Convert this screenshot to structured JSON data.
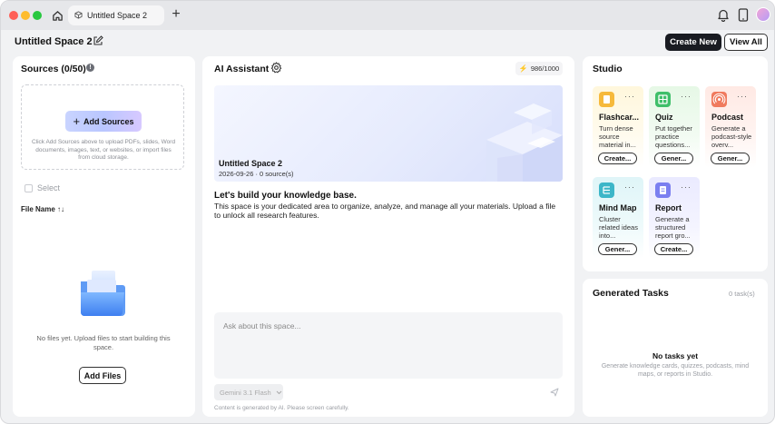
{
  "titlebar": {
    "tab_label": "Untitled Space 2",
    "new_tab_symbol": "+"
  },
  "header": {
    "space_title": "Untitled Space 2",
    "create_new_label": "Create New",
    "view_all_label": "View All"
  },
  "sources": {
    "title": "Sources (0/50)",
    "info_symbol": "!",
    "add_sources_label": "Add Sources",
    "dropzone_hint": "Click Add Sources above to upload PDFs, slides, Word documents, images, text, or websites, or import files from cloud storage.",
    "select_label": "Select",
    "file_name_header": "File Name ↑↓",
    "empty_message": "No files yet. Upload files to start building this space.",
    "add_files_label": "Add Files"
  },
  "assistant": {
    "title": "AI Assistant",
    "credits": "986/1000",
    "hero_title": "Untitled Space 2",
    "hero_subtitle": "2026-09-26 · 0 source(s)",
    "kb_title": "Let's build your knowledge base.",
    "kb_description": "This space is your dedicated area to organize, analyze, and manage all your materials. Upload a file to unlock all research features.",
    "input_placeholder": "Ask about this space...",
    "model_label": "Gemini 3.1 Flash",
    "disclaimer": "Content is generated by AI. Please screen carefully."
  },
  "studio": {
    "title": "Studio",
    "more_symbol": "···",
    "cards": [
      {
        "title": "Flashcar...",
        "desc": "Turn dense source material in...",
        "button": "Create...",
        "color": "#f6b93b"
      },
      {
        "title": "Quiz",
        "desc": "Put together practice questions...",
        "button": "Gener...",
        "color": "#3fbf6a"
      },
      {
        "title": "Podcast",
        "desc": "Generate a podcast-style overv...",
        "button": "Gener...",
        "color": "#f07a5e"
      },
      {
        "title": "Mind Map",
        "desc": "Cluster related ideas into...",
        "button": "Gener...",
        "color": "#3db6c8"
      },
      {
        "title": "Report",
        "desc": "Generate a structured report gro...",
        "button": "Create...",
        "color": "#7b7ff0"
      }
    ]
  },
  "tasks": {
    "title": "Generated Tasks",
    "count": "0 task(s)",
    "empty_title": "No tasks yet",
    "empty_desc": "Generate knowledge cards, quizzes, podcasts, mind maps, or reports in Studio."
  }
}
